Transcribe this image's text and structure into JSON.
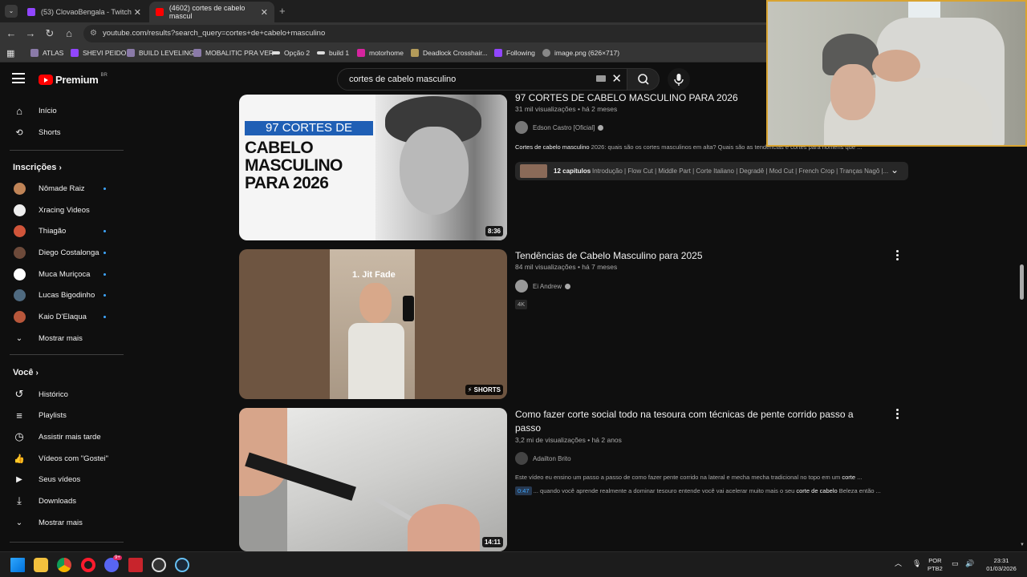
{
  "browser": {
    "tabs": [
      {
        "title": "(53) ClovaoBengala - Twitch"
      },
      {
        "title": "(4602) cortes de cabelo mascul"
      }
    ],
    "url": "youtube.com/results?search_query=cortes+de+cabelo+masculino",
    "bookmarks": [
      "ATLAS",
      "SHEVI PEIDO",
      "BUILD LEVELING",
      "MOBALITIC PRA VER",
      "Opção 2",
      "build 1",
      "motorhome",
      "Deadlock Crosshair...",
      "Following",
      "image.png (626×717)"
    ]
  },
  "masthead": {
    "logo_text": "Premium",
    "country": "BR",
    "search_query": "cortes de cabelo masculino"
  },
  "sidebar": {
    "top": [
      {
        "label": "Início",
        "icon": "home-icon"
      },
      {
        "label": "Shorts",
        "icon": "shorts-icon"
      }
    ],
    "subs_title": "Inscrições",
    "subscriptions": [
      {
        "label": "Nômade Raiz",
        "color": "#c08457"
      },
      {
        "label": "Xracing Videos",
        "color": "#eeeeee"
      },
      {
        "label": "Thiagão",
        "color": "#d0553a"
      },
      {
        "label": "Diego Costalonga",
        "color": "#6d4a3a"
      },
      {
        "label": "Muca Muriçoca",
        "color": "#ffffff"
      },
      {
        "label": "Lucas Bigodinho",
        "color": "#4f6a80"
      },
      {
        "label": "Kaio D'Elaqua",
        "color": "#b8573b"
      }
    ],
    "subs_more": "Mostrar mais",
    "you_title": "Você",
    "you_items": [
      {
        "label": "Histórico",
        "icon": "history-icon"
      },
      {
        "label": "Playlists",
        "icon": "playlist-icon"
      },
      {
        "label": "Assistir mais tarde",
        "icon": "clock-icon"
      },
      {
        "label": "Vídeos com \"Gostei\"",
        "icon": "thumbs-up-icon"
      },
      {
        "label": "Seus vídeos",
        "icon": "video-icon"
      },
      {
        "label": "Downloads",
        "icon": "download-icon"
      },
      {
        "label": "Mostrar mais",
        "icon": "chevron-down-icon"
      }
    ]
  },
  "videos": [
    {
      "title": "97 CORTES DE CABELO MASCULINO PARA 2026",
      "meta": "31 mil visualizações • há 2 meses",
      "channel": "Edson Castro [Oficial]",
      "desc_bold": "Cortes de cabelo masculino",
      "desc": " 2026: quais são os cortes masculinos em alta? Quais são as tendências e cortes para homens que ...",
      "chapters_count": "12 capítulos",
      "chapters": "Introdução | Flow Cut | Middle Part | Corte Italiano | Degradê | Mod Cut | French Crop | Tranças Nagô |...",
      "duration": "8:36",
      "thumb_banner": "97 CORTES DE",
      "thumb_big": "CABELO MASCULINO PARA 2026"
    },
    {
      "title": "Tendências de Cabelo Masculino para 2025",
      "meta": "84 mil visualizações • há 7 meses",
      "channel": "Ei Andrew",
      "badge": "4K",
      "thumb_caption": "1. Jit Fade",
      "shorts_label": "SHORTS"
    },
    {
      "title": "Como fazer corte social todo na tesoura com técnicas de pente corrido passo a passo",
      "meta": "3,2 mi de visualizações • há 2 anos",
      "channel": "Adailton Brito",
      "desc": "Este vídeo eu ensino um passo a passo de como fazer pente corrido na lateral e mecha mecha tradicional no topo em um ",
      "desc_bold": "corte",
      "desc_tail": " ...",
      "timestamp": "0:47",
      "desc2": " ... quando você aprende realmente a dominar tesouro entende você vai acelerar muito mais o seu ",
      "desc2_bold": "corte de cabelo",
      "desc2_tail": " Beleza então ...",
      "duration": "14:11"
    }
  ],
  "taskbar": {
    "lang": "POR",
    "layout": "PTB2",
    "time": "23:31",
    "date": "01/03/2026",
    "badge": "9+"
  }
}
